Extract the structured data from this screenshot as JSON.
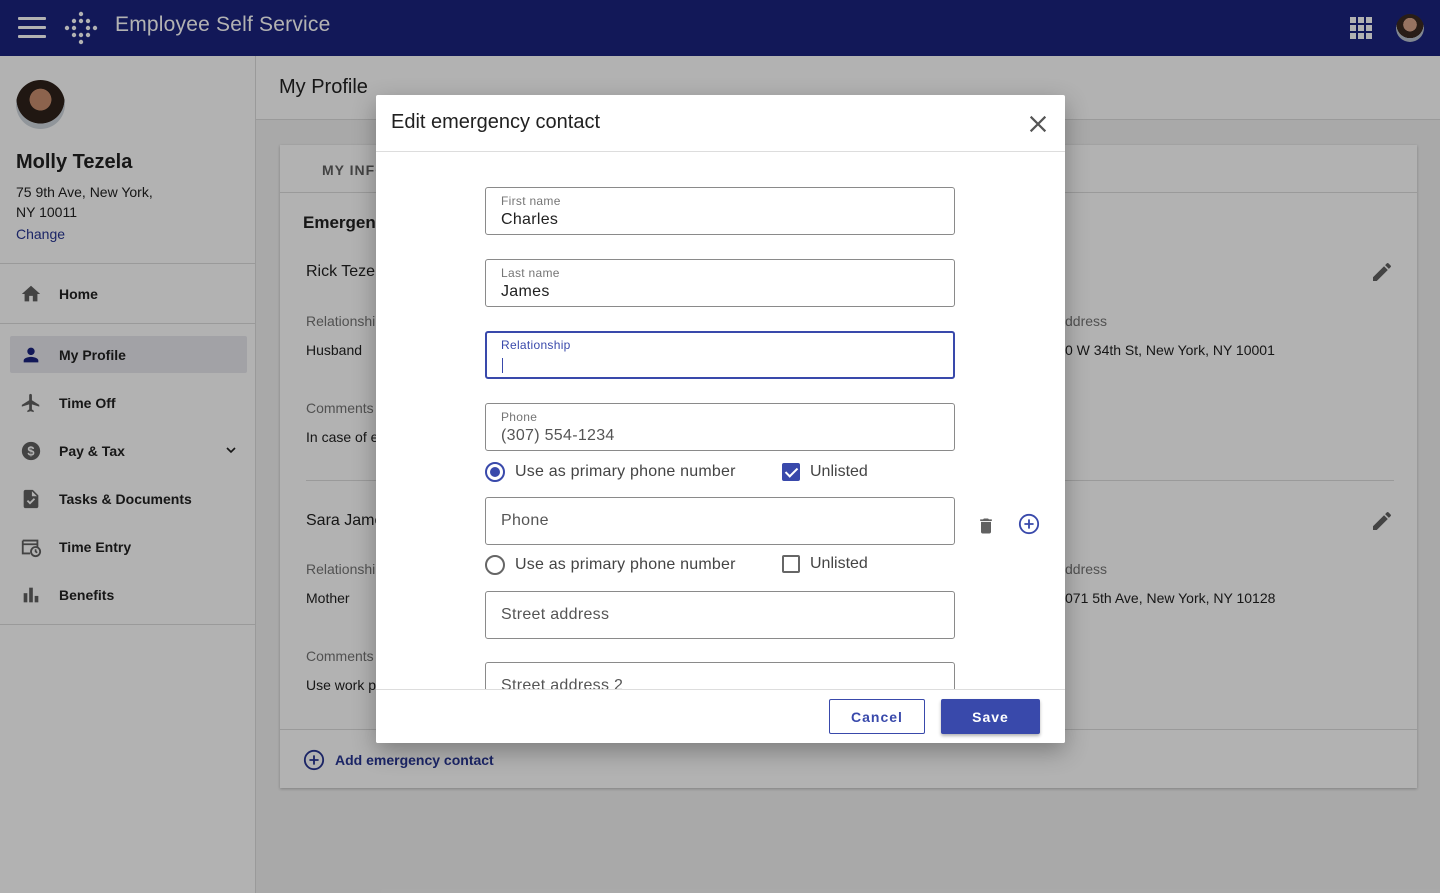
{
  "app": {
    "title": "Employee Self Service",
    "icons": [
      "menu-icon",
      "logo-icon",
      "apps-grid-icon",
      "user-avatar"
    ]
  },
  "profile": {
    "name": "Molly Tezela",
    "address_line1": "75 9th Ave, New York,",
    "address_line2": "NY 10011",
    "change_label": "Change"
  },
  "nav": {
    "home": "Home",
    "my_profile": "My Profile",
    "time_off": "Time Off",
    "pay_tax": "Pay & Tax",
    "tasks_documents": "Tasks & Documents",
    "time_entry": "Time Entry",
    "benefits": "Benefits",
    "active": "My Profile"
  },
  "main": {
    "page_title": "My Profile",
    "tab_partial": "MY INFO",
    "section_title_partial": "Emergenc",
    "contacts": [
      {
        "name_partial": "Rick Tezel",
        "relationship_label_partial": "Relationshi",
        "relationship": "Husband",
        "address_label_partial": "ddress",
        "address_partial": "0 W 34th St, New York, NY 10001",
        "comments_label": "Comments",
        "comments_partial": "In case of e"
      },
      {
        "name_partial": "Sara Jame",
        "relationship_label_partial": "Relationshi",
        "relationship": "Mother",
        "address_label_partial": "ddress",
        "address_partial": "071 5th Ave, New York, NY 10128",
        "comments_label": "Comments",
        "comments_partial": "Use work p"
      }
    ],
    "add_contact_label": "Add emergency contact"
  },
  "dialog": {
    "title": "Edit emergency contact",
    "first_name": {
      "label": "First name",
      "value": "Charles"
    },
    "last_name": {
      "label": "Last name",
      "value": "James"
    },
    "relationship": {
      "label": "Relationship",
      "value": ""
    },
    "phone1": {
      "label": "Phone",
      "value": "(307) 554-1234",
      "primary": true,
      "unlisted": true
    },
    "phone2": {
      "placeholder": "Phone",
      "primary": false,
      "unlisted": false
    },
    "primary_label": "Use as primary phone number",
    "unlisted_label": "Unlisted",
    "street1_placeholder": "Street address",
    "street2_placeholder": "Street address 2",
    "cancel_label": "Cancel",
    "save_label": "Save"
  },
  "colors": {
    "primary": "#1a237e",
    "accent": "#3949ab",
    "link": "#283593"
  }
}
